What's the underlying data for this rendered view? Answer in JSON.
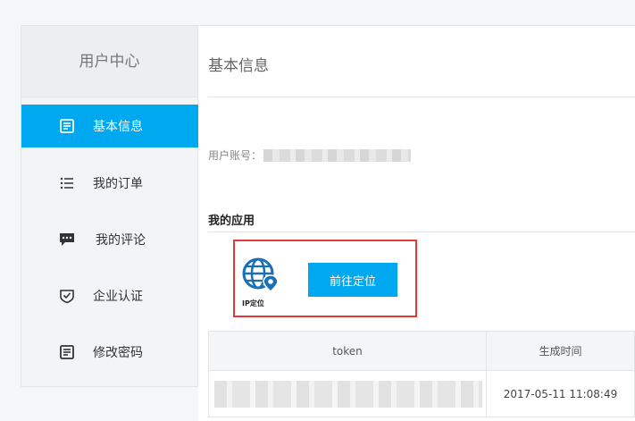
{
  "sidebar": {
    "title": "用户中心",
    "items": [
      {
        "label": "基本信息",
        "icon": "note-icon",
        "active": true
      },
      {
        "label": "我的订单",
        "icon": "list-icon",
        "active": false
      },
      {
        "label": "我的评论",
        "icon": "comment-icon",
        "active": false
      },
      {
        "label": "企业认证",
        "icon": "shield-check-icon",
        "active": false
      },
      {
        "label": "修改密码",
        "icon": "edit-note-icon",
        "active": false
      }
    ]
  },
  "main": {
    "title": "基本信息",
    "account_label": "用户账号：",
    "apps_title": "我的应用",
    "app": {
      "icon_label": "IP定位",
      "button_label": "前往定位"
    },
    "table": {
      "headers": [
        "token",
        "生成时间"
      ],
      "rows": [
        {
          "token": "",
          "time": "2017-05-11 11:08:49"
        }
      ]
    }
  },
  "colors": {
    "accent": "#00a8f0",
    "highlight_border": "#e03a3a"
  }
}
